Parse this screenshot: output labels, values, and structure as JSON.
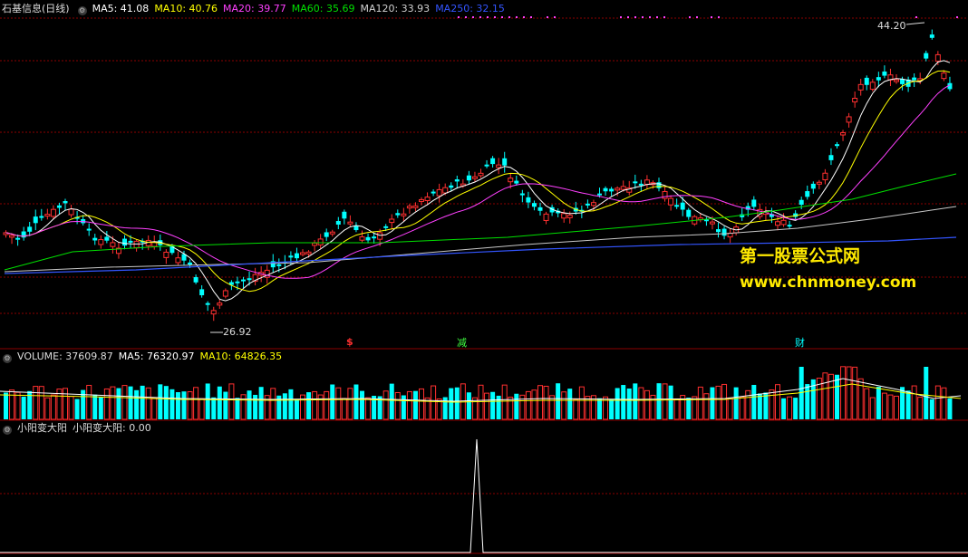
{
  "main": {
    "title": "石基信息(日线)",
    "ma": [
      {
        "label": "MA5: 41.08",
        "color": "#ffffff"
      },
      {
        "label": "MA10: 40.76",
        "color": "#ffff00"
      },
      {
        "label": "MA20: 39.77",
        "color": "#ff40ff"
      },
      {
        "label": "MA60: 35.69",
        "color": "#00e000"
      },
      {
        "label": "MA120: 33.93",
        "color": "#c8c8c8"
      },
      {
        "label": "MA250: 32.15",
        "color": "#3355ff"
      }
    ],
    "high_label": "44.20",
    "low_label": "26.92",
    "markers": [
      {
        "text": "$",
        "color": "#ff3030"
      },
      {
        "text": "减",
        "color": "#40ff40"
      },
      {
        "text": "财",
        "color": "#00ffff"
      }
    ]
  },
  "watermark": {
    "line1": "第一股票公式网",
    "line2": "www.chnmoney.com"
  },
  "volume": {
    "label": "VOLUME: 37609.87",
    "ma5": "MA5: 76320.97",
    "ma10": "MA10: 64826.35"
  },
  "indicator": {
    "label": "小阳变大阳",
    "value": "小阳变大阳: 0.00"
  },
  "colors": {
    "up": "#ff3030",
    "down": "#00ffff",
    "grid": "#8c0000",
    "background": "#000000"
  }
}
